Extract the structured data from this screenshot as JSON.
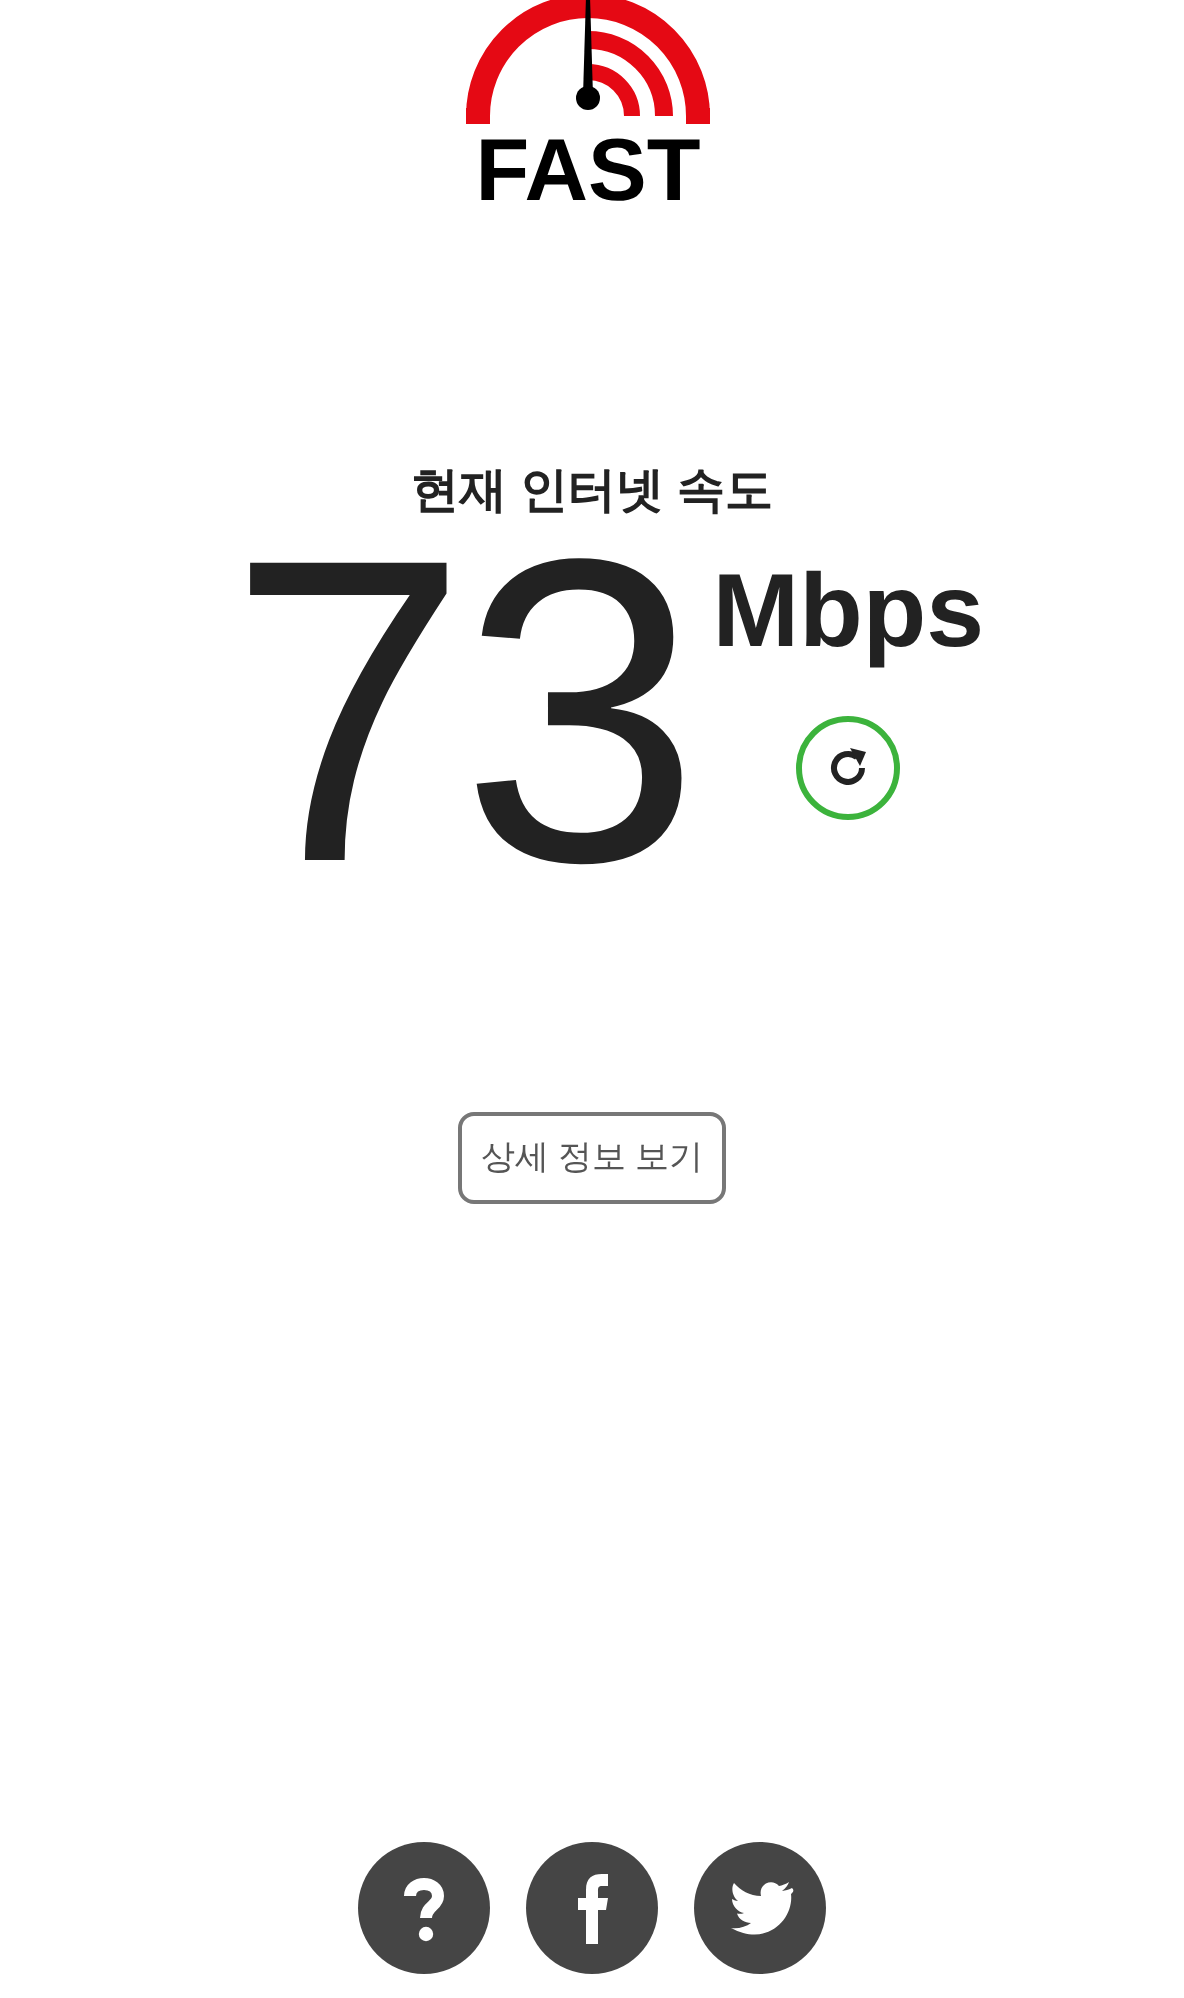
{
  "logo": {
    "text": "FAST"
  },
  "speed": {
    "label": "현재 인터넷 속도",
    "value": "73",
    "unit": "Mbps",
    "completed": true
  },
  "details_button": {
    "label": "상세 정보 보기"
  },
  "footer": {
    "links": [
      {
        "kind": "help"
      },
      {
        "kind": "facebook"
      },
      {
        "kind": "twitter"
      }
    ]
  }
}
